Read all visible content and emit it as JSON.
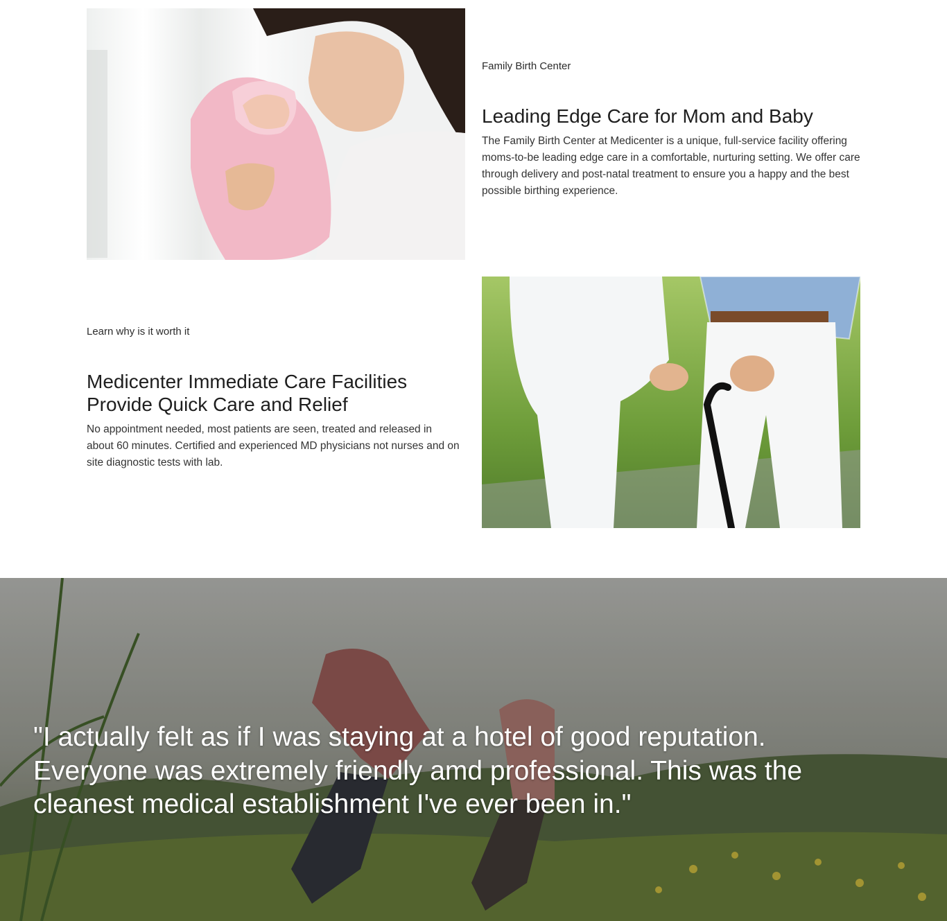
{
  "birth_center": {
    "eyebrow": "Family Birth Center",
    "heading": "Leading Edge Care for Mom and Baby",
    "body": "The Family Birth Center at Medicenter is a unique, full-service facility offering moms-to-be leading edge care in a comfortable, nurturing setting. We offer care through delivery and post-natal treatment to ensure you a happy and the best possible birthing experience."
  },
  "immediate_care": {
    "eyebrow": "Learn why is it worth it",
    "heading": "Medicenter Immediate Care Facilities Provide Quick Care and Relief",
    "body": "No appointment needed, most patients are seen, treated and released in about 60 minutes. Certified and experienced MD physicians not nurses and on site diagnostic tests with lab."
  },
  "testimonial": {
    "quote": "\"I actually felt as if I was staying at a hotel of good reputation. Everyone was extremely friendly amd professional. This was the cleanest medical establishment I've ever been in.\""
  },
  "colors": {
    "text_dark": "#1e1e1e",
    "quote_text": "#ffffff",
    "blanket_pink": "#f2b8c6"
  }
}
